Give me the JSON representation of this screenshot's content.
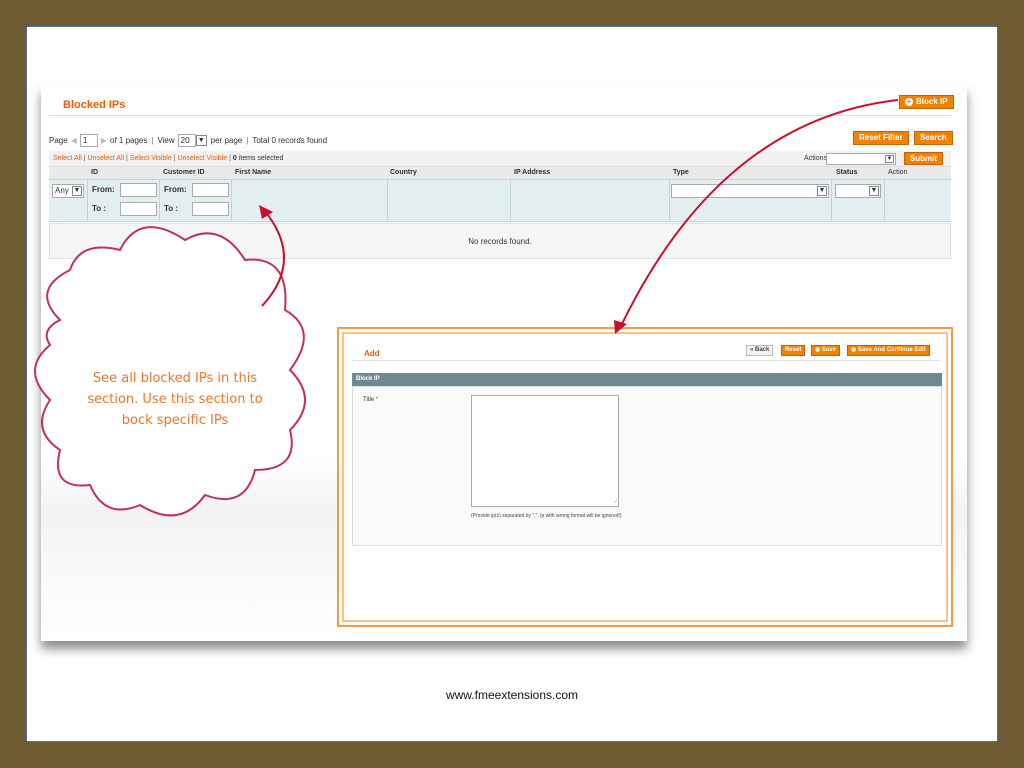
{
  "page": {
    "title": "Blocked IPs",
    "block_ip_label": "Block IP",
    "reset_filter_label": "Reset Filter",
    "search_label": "Search"
  },
  "pager": {
    "page_label": "Page",
    "page_value": "1",
    "of_pages": "of 1 pages",
    "view_label": "View",
    "per_page_value": "20",
    "per_page_label": "per page",
    "total_records": "Total 0 records found"
  },
  "massaction": {
    "select_all": "Select All",
    "unselect_all": "Unselect All",
    "select_visible": "Select Visible",
    "unselect_visible": "Unselect Visible",
    "items_count": "0",
    "items_selected": "items selected",
    "actions_label": "Actions",
    "submit_label": "Submit"
  },
  "grid": {
    "columns": [
      "ID",
      "Customer ID",
      "First Name",
      "Country",
      "IP Address",
      "Type",
      "Status",
      "Action"
    ],
    "filter_any": "Any",
    "from_label": "From:",
    "to_label": "To :",
    "empty_text": "No records found."
  },
  "callout": {
    "text": "See all blocked IPs in this section. Use this section to bock specific IPs"
  },
  "form": {
    "title": "Add",
    "back_label": "Back",
    "reset_label": "Reset",
    "save_label": "Save",
    "save_continue_label": "Save And Continue Edit",
    "section_title": "Block IP",
    "field_label": "Title",
    "required_mark": "*",
    "hint": "(Provide ip(s) separated by \",\". Ip with wrong format will be ignored!)"
  },
  "footer": {
    "url": "www.fmeextensions.com"
  },
  "colors": {
    "accent": "#eb5e00",
    "button": "#f18200",
    "arrow": "#c8102e",
    "frame": "#6f5c33"
  }
}
